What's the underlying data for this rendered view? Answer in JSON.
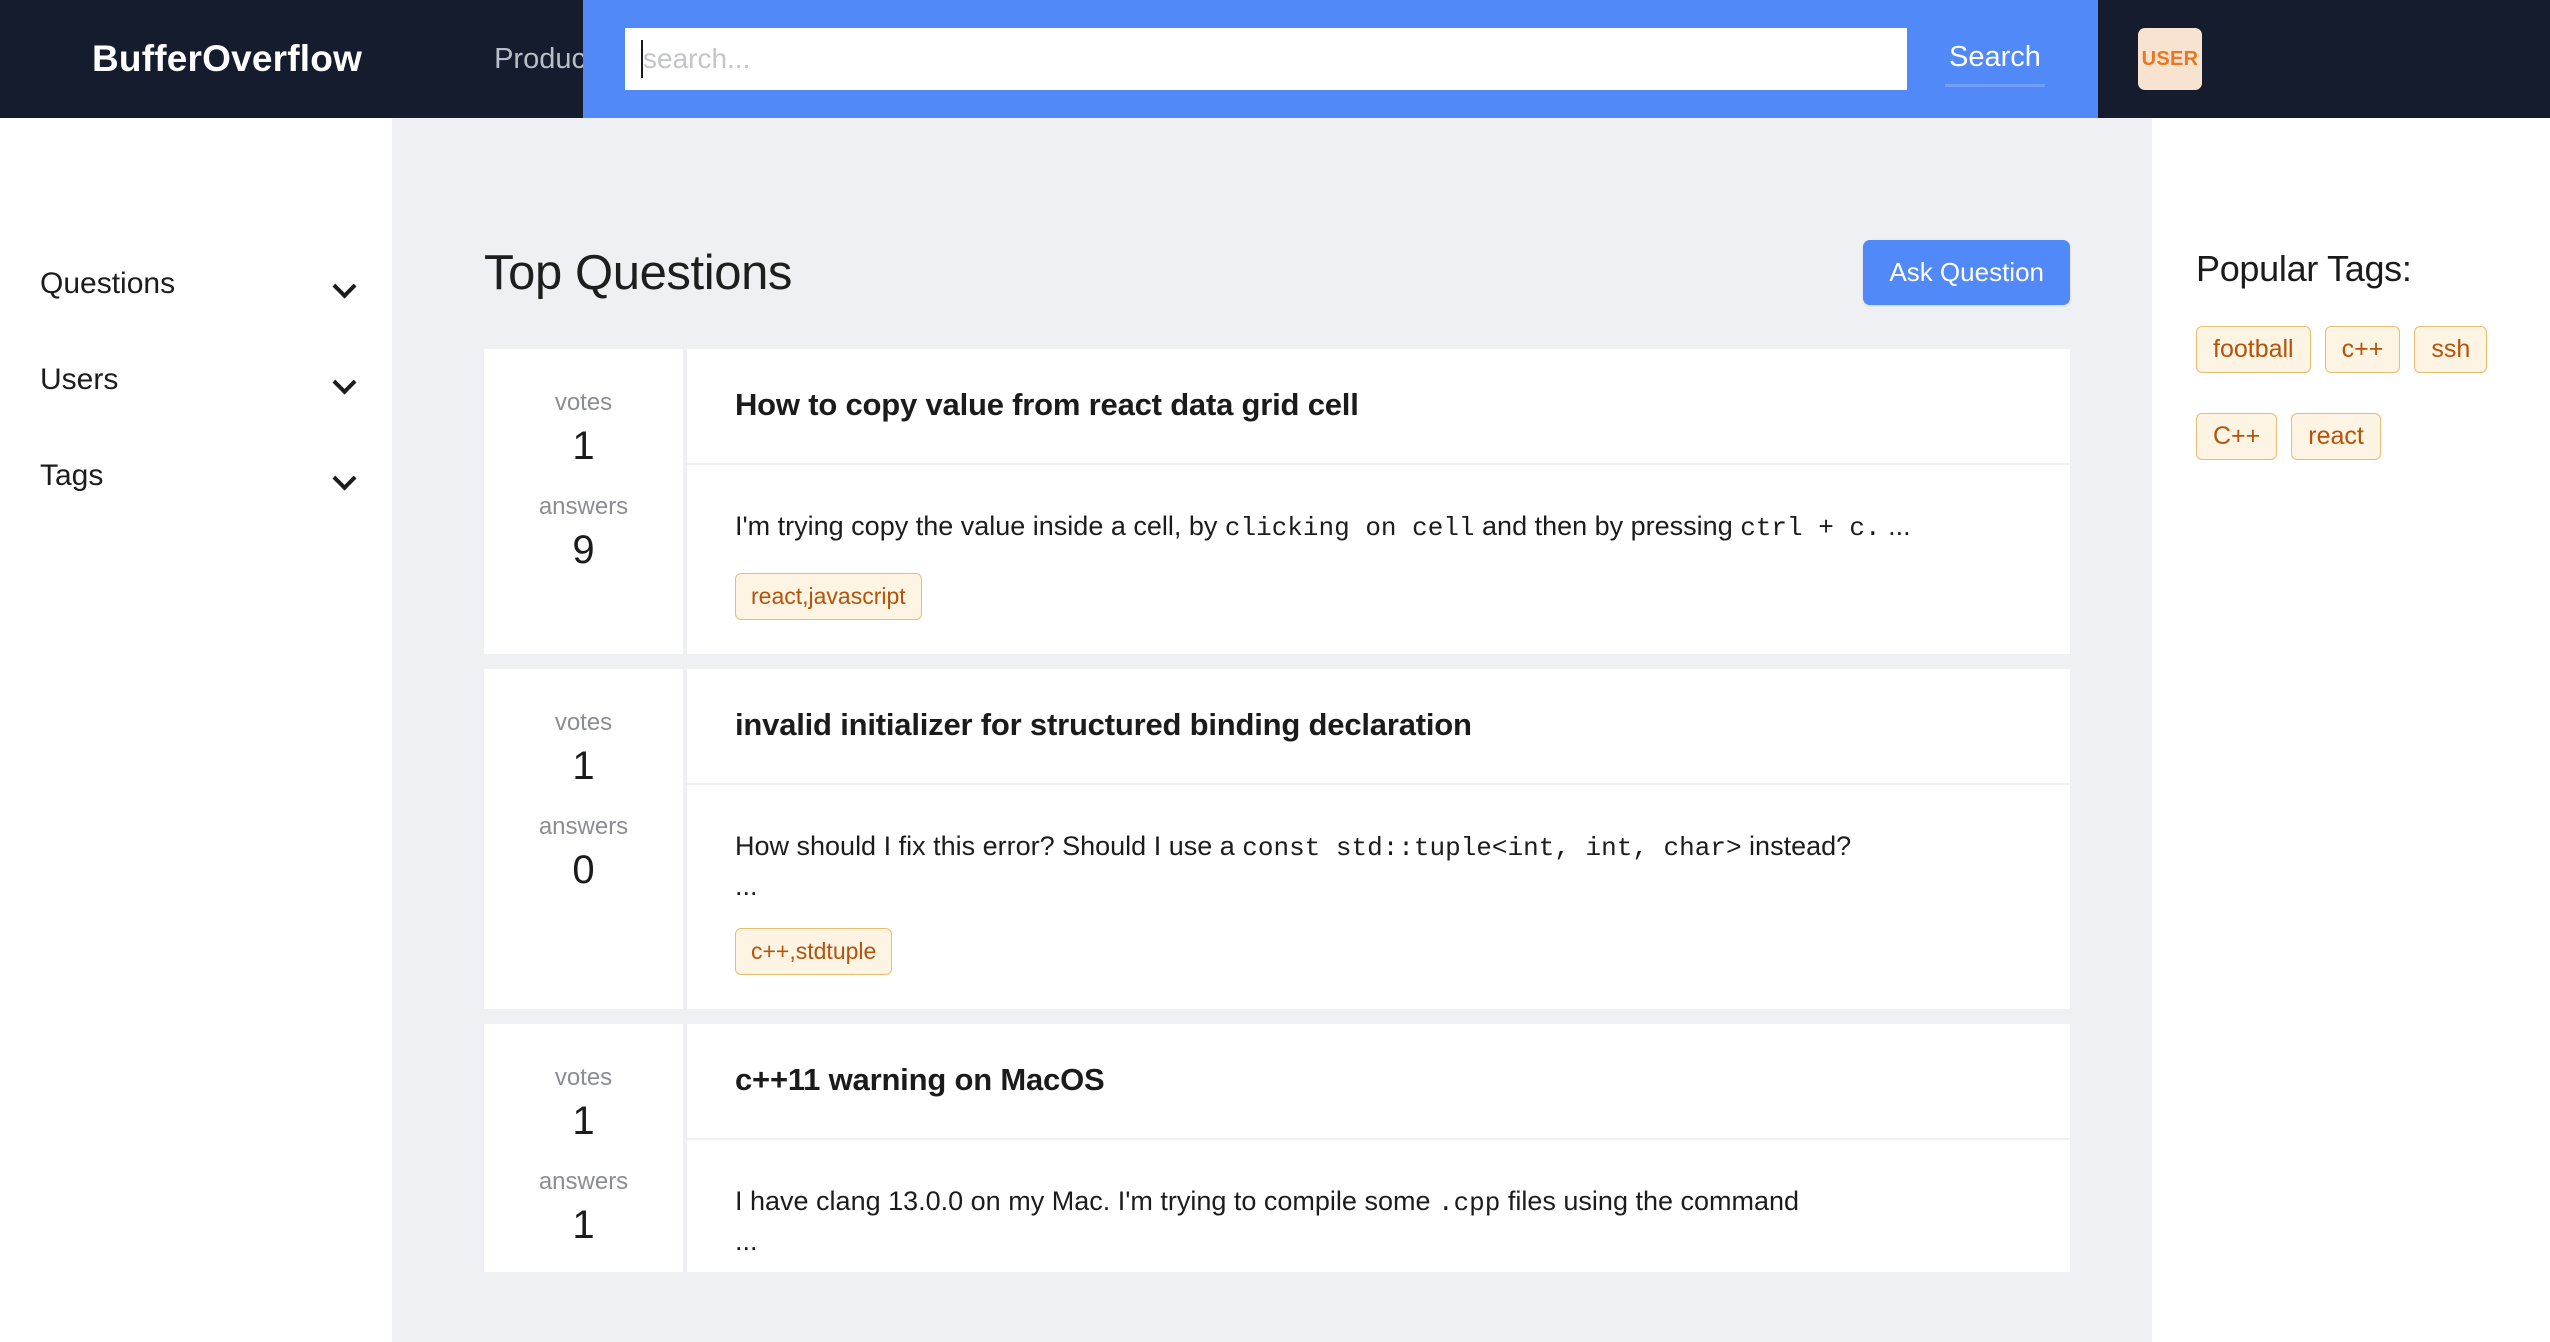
{
  "header": {
    "brand": "BufferOverflow",
    "nav_products": "Products",
    "search_placeholder": "search...",
    "search_value": "",
    "search_button": "Search",
    "user_badge": "USER",
    "bar_color": "#141c2e",
    "accent_color": "#5189f8"
  },
  "sidebar": {
    "items": [
      {
        "label": "Questions",
        "icon": "chevron-down-icon"
      },
      {
        "label": "Users",
        "icon": "chevron-down-icon"
      },
      {
        "label": "Tags",
        "icon": "chevron-down-icon"
      }
    ]
  },
  "main": {
    "title": "Top Questions",
    "ask_button": "Ask Question",
    "stat_labels": {
      "votes": "votes",
      "answers": "answers"
    },
    "questions": [
      {
        "title": "How to copy value from react data grid cell",
        "votes": "1",
        "answers": "9",
        "excerpt_parts": [
          {
            "text": "I'm trying copy the value inside a cell, by ",
            "code": false
          },
          {
            "text": "clicking on cell",
            "code": true
          },
          {
            "text": " and then by pressing ",
            "code": false
          },
          {
            "text": "ctrl + c.",
            "code": true
          },
          {
            "text": " ...",
            "code": false
          }
        ],
        "ellipsis": "",
        "tags": [
          "react,javascript"
        ]
      },
      {
        "title": "invalid initializer for structured binding declaration",
        "votes": "1",
        "answers": "0",
        "excerpt_parts": [
          {
            "text": "How should I fix this error? Should I use a ",
            "code": false
          },
          {
            "text": "const std::tuple<int, int, char>",
            "code": true
          },
          {
            "text": " instead?",
            "code": false
          }
        ],
        "ellipsis": "...",
        "tags": [
          "c++,stdtuple"
        ]
      },
      {
        "title": "c++11 warning on MacOS",
        "votes": "1",
        "answers": "1",
        "excerpt_parts": [
          {
            "text": "I have clang 13.0.0 on my Mac. I'm trying to compile some ",
            "code": false
          },
          {
            "text": ".cpp",
            "code": true
          },
          {
            "text": " files using the command",
            "code": false
          }
        ],
        "ellipsis": "...",
        "tags": []
      }
    ]
  },
  "right_panel": {
    "title": "Popular Tags:",
    "tag_rows": [
      [
        "football",
        "c++",
        "ssh"
      ],
      [
        "C++",
        "react"
      ]
    ],
    "pill_bg": "#fdf4e3",
    "pill_border": "#e8bd72",
    "pill_text": "#b45309"
  }
}
